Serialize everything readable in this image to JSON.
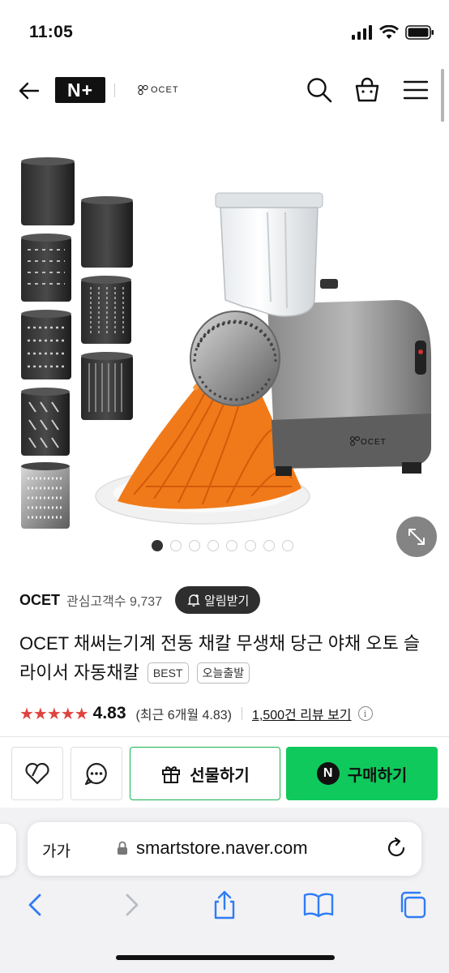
{
  "status_bar": {
    "time": "11:05"
  },
  "header": {
    "nplus_label": "N+",
    "brand_logo_text": "OCET"
  },
  "product_image": {
    "device_logo": "OCET",
    "carousel": {
      "total": 8,
      "active": 1
    }
  },
  "store": {
    "brand": "OCET",
    "fans_label": "관심고객수 9,737",
    "alert_button": "알림받기"
  },
  "product": {
    "title": "OCET 채써는기계 전동 채칼 무생채 당근 야채 오토 슬라이서 자동채칼",
    "tags": [
      "BEST",
      "오늘출발"
    ],
    "stars": "★★★★★",
    "rating": "4.83",
    "rating_value": 4.83,
    "recent_rating": "(최근 6개월 4.83)",
    "reviews_link": "1,500건 리뷰 보기"
  },
  "actions": {
    "gift_label": "선물하기",
    "buy_label": "구매하기",
    "buy_badge": "N"
  },
  "browser": {
    "text_size": "가가",
    "url": "smartstore.naver.com"
  },
  "icons": [
    "back-arrow-icon",
    "search-icon",
    "cart-icon",
    "menu-icon",
    "expand-icon",
    "heart-icon",
    "chat-icon",
    "gift-icon",
    "lock-icon",
    "reload-icon",
    "nav-back-icon",
    "nav-forward-icon",
    "share-icon",
    "bookmarks-icon",
    "tabs-icon"
  ],
  "colors": {
    "star": "#e0433f",
    "buy": "#10c95c",
    "gift_border": "#17b34d",
    "carrot": "#f07a1a"
  }
}
